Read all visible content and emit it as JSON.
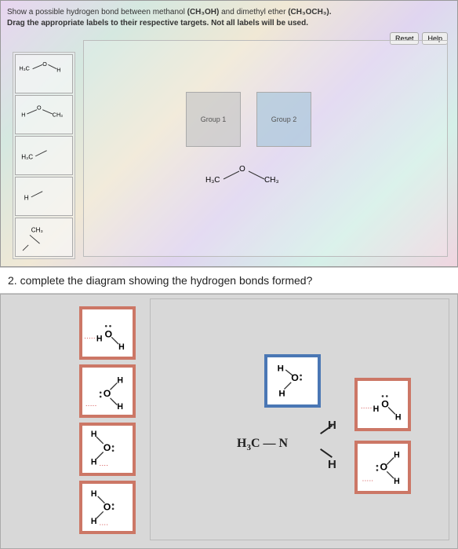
{
  "panel1": {
    "instruction_line1_a": "Show a possible hydrogen bond between methanol ",
    "instruction_line1_b": " and dimethyl ether ",
    "formula1": "(CH₃OH)",
    "formula2": "(CH₃OCH₃).",
    "instruction_line2": "Drag the appropriate labels to their respective targets. Not all labels will be used.",
    "reset": "Reset",
    "help": "Help",
    "group1": "Group 1",
    "group2": "Group 2",
    "central_mol": "H₃C―O―CH₃",
    "tiles": {
      "t1": "H₃C―O―H",
      "t2": "H―O―CH₃",
      "t3": "H₃C",
      "t4": "H",
      "t5": "CH₃"
    }
  },
  "question2": "2. complete the diagram showing the hydrogen bonds formed?",
  "panel2": {
    "central": "H₃C — N",
    "h_top": "H",
    "h_bot": "H",
    "palette": {
      "p1_desc": "O with lone pairs, ···H left, H right-below",
      "p2_desc": "O with lone pairs, H upper-right, ···H lower-right",
      "p3_desc": "O with lone pairs, H upper-left, H··· lower-left",
      "p4_desc": "O with lone pairs, H upper-right, H lower-left···"
    },
    "drops": {
      "d1_desc": "blue: H—O:, H below",
      "d2_desc": "red: :O, ···H left, H right",
      "d3_desc": "red: :O, H upper-right, ···H lower-right"
    }
  }
}
